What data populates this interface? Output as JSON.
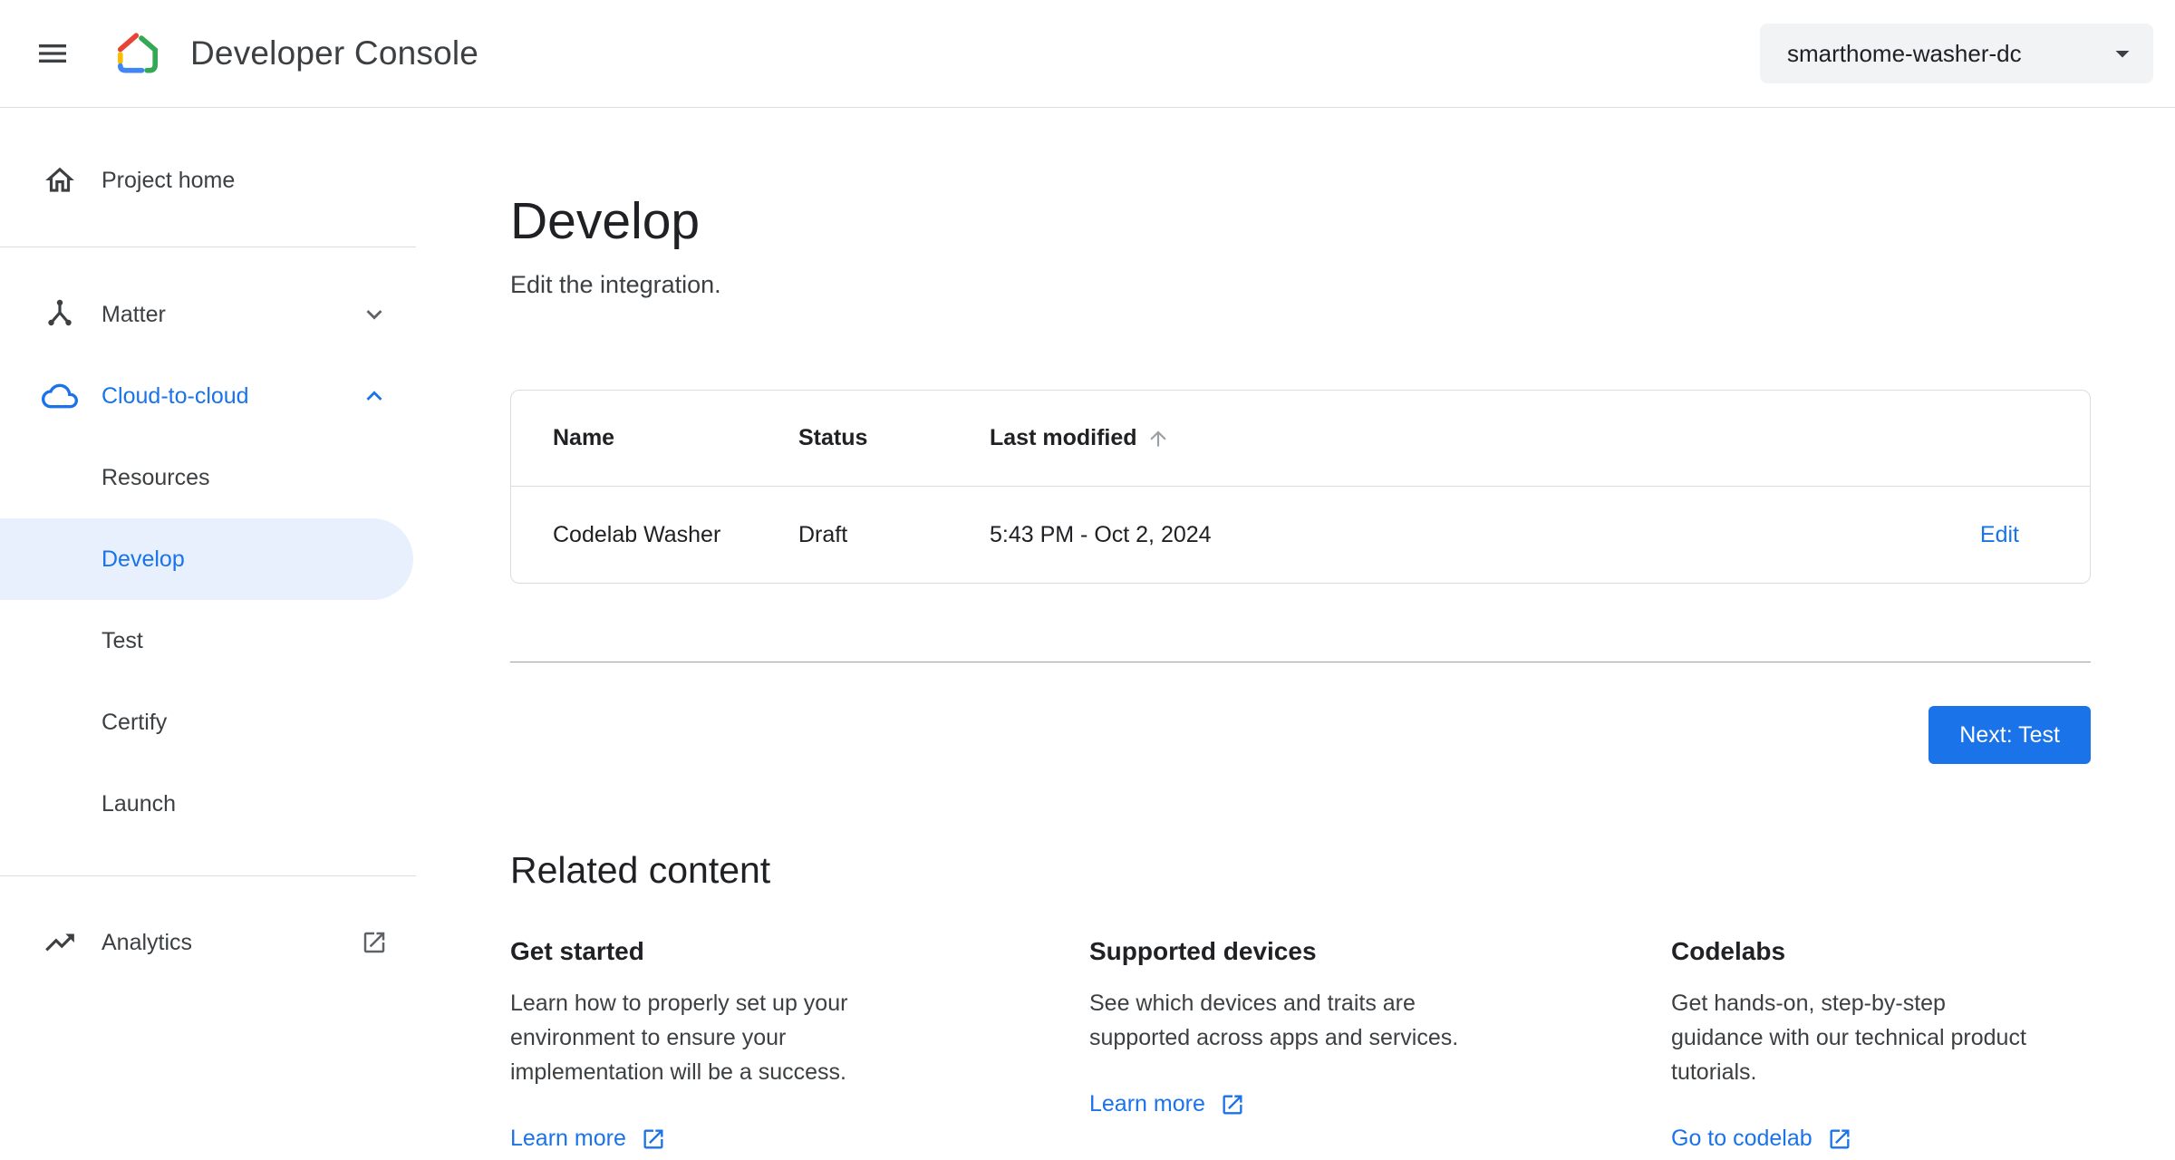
{
  "header": {
    "title": "Developer Console",
    "project_selector": {
      "value": "smarthome-washer-dc"
    }
  },
  "sidebar": {
    "project_home": {
      "label": "Project home"
    },
    "matter": {
      "label": "Matter"
    },
    "cloud_to_cloud": {
      "label": "Cloud-to-cloud",
      "children": [
        "Resources",
        "Develop",
        "Test",
        "Certify",
        "Launch"
      ],
      "active_child": "Develop"
    },
    "analytics": {
      "label": "Analytics"
    }
  },
  "main": {
    "title": "Develop",
    "subtitle": "Edit the integration.",
    "table": {
      "headers": {
        "name": "Name",
        "status": "Status",
        "last_modified": "Last modified"
      },
      "sort_column": "Last modified",
      "rows": [
        {
          "name": "Codelab Washer",
          "status": "Draft",
          "last_modified": "5:43 PM - Oct 2, 2024",
          "action": "Edit"
        }
      ]
    },
    "next_button": "Next: Test",
    "related": {
      "heading": "Related content",
      "cards": [
        {
          "title": "Get started",
          "body": "Learn how to properly set up your\nenvironment to ensure your\nimplementation will be a success.",
          "link": "Learn more"
        },
        {
          "title": "Supported devices",
          "body": "See which devices and traits are\nsupported across apps and services.",
          "link": "Learn more"
        },
        {
          "title": "Codelabs",
          "body": "Get hands-on, step-by-step\nguidance with our technical product\ntutorials.",
          "link": "Go to codelab"
        }
      ]
    }
  },
  "colors": {
    "accent_blue": "#1a73e8",
    "selected_pill": "#e8f0fe",
    "header_border": "#dadce0",
    "button_bg": "#1a73e8",
    "logo_red": "#ea4335",
    "logo_green": "#34a853",
    "logo_yellow": "#fbbc04",
    "logo_blue": "#4285f4"
  },
  "icons": {
    "menu-icon": "hamburger",
    "google-home-logo": "multicolor-house",
    "home-icon": "house-outline",
    "matter-icon": "matter-node",
    "cloud-icon": "cloud-outline",
    "chevron-down-icon": "expand-more",
    "chevron-up-icon": "expand-less",
    "analytics-icon": "trending-up",
    "open-in-new-icon": "external-link",
    "sort-arrow-icon": "arrow-upward",
    "dropdown-arrow-icon": "caret-down"
  }
}
